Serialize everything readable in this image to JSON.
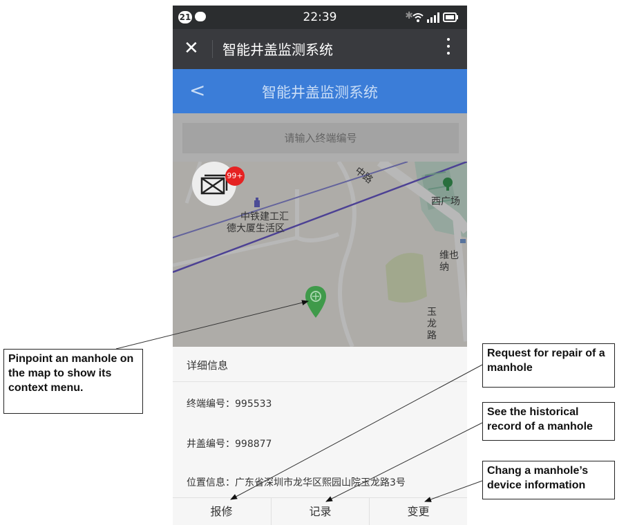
{
  "status_bar": {
    "notification_count": "21",
    "time": "22:39",
    "icons": [
      "chat-bubble-icon",
      "bluetooth-icon",
      "wifi-icon",
      "signal-icon",
      "battery-icon"
    ]
  },
  "title_bar": {
    "close_icon": "close-icon",
    "title": "智能井盖监测系统",
    "menu_icon": "more-vertical-icon"
  },
  "app_header": {
    "back_icon": "chevron-left-icon",
    "title": "智能井盖监测系统",
    "color": "#3b7dd8"
  },
  "search": {
    "placeholder": "请输入终端编号"
  },
  "map": {
    "labels": {
      "road": "中路",
      "building": "中铁建工汇",
      "building2": "德大厦生活区",
      "square": "西广场",
      "weiye": "维也纳",
      "yulong": "玉龙路"
    },
    "message_button": {
      "icon": "mail-icon",
      "badge": "99+"
    },
    "marker_icon": "location-pin-icon"
  },
  "details": {
    "heading": "详细信息",
    "terminal_id": "终端编号：995533",
    "cover_id": "井盖编号：998877",
    "location": "位置信息：广东省深圳市龙华区熙园山院玉龙路3号"
  },
  "actions": {
    "repair": "报修",
    "record": "记录",
    "change": "变更"
  },
  "callouts": {
    "pinpoint": "Pinpoint an manhole on the map to show its context menu.",
    "repair": "Request for repair of a manhole",
    "record": "See the historical record of a manhole",
    "change": "Chang a manhole’s device information"
  }
}
